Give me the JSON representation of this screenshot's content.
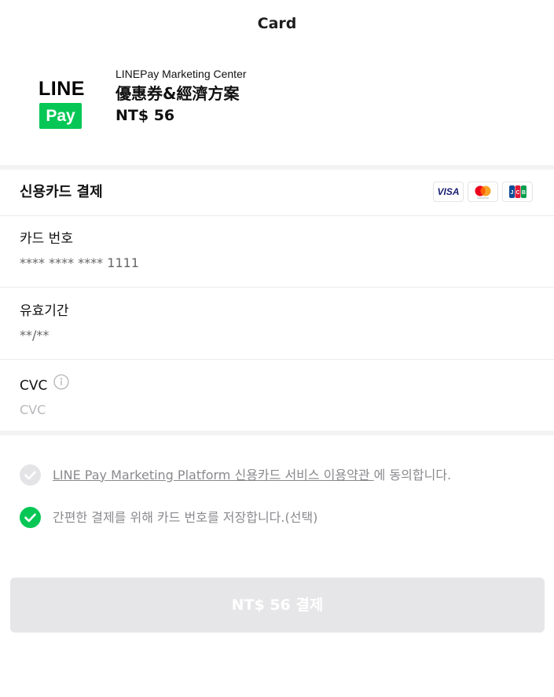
{
  "header": {
    "title": "Card"
  },
  "merchant": {
    "logo_line_text": "LINE",
    "logo_pay_text": "Pay",
    "name": "LINEPay Marketing Center",
    "product": "優惠券&經濟方案",
    "price": "NT$ 56"
  },
  "payment_section": {
    "title": "신용카드 결제",
    "brands": [
      {
        "name": "VISA",
        "icon": "visa-logo"
      },
      {
        "name": "Mastercard",
        "icon": "mastercard-logo"
      },
      {
        "name": "JCB",
        "icon": "jcb-logo"
      }
    ]
  },
  "fields": {
    "card_number": {
      "label": "카드 번호",
      "value": "**** **** **** 1111"
    },
    "expiry": {
      "label": "유효기간",
      "value": "**/**"
    },
    "cvc": {
      "label": "CVC",
      "placeholder": "CVC",
      "icon": "info-icon"
    }
  },
  "consents": [
    {
      "link_text": "LINE Pay Marketing Platform 신용카드 서비스 이용약관 ",
      "suffix": "에 동의합니다.",
      "checked": false
    },
    {
      "text": "간편한 결제를 위해 카드 번호를 저장합니다.(선택)",
      "checked": true
    }
  ],
  "pay_button": {
    "label": "NT$ 56 결제"
  },
  "colors": {
    "line_green": "#06c755",
    "button_disabled": "#e6e6e8",
    "check_unchecked": "#e4e4e6"
  }
}
